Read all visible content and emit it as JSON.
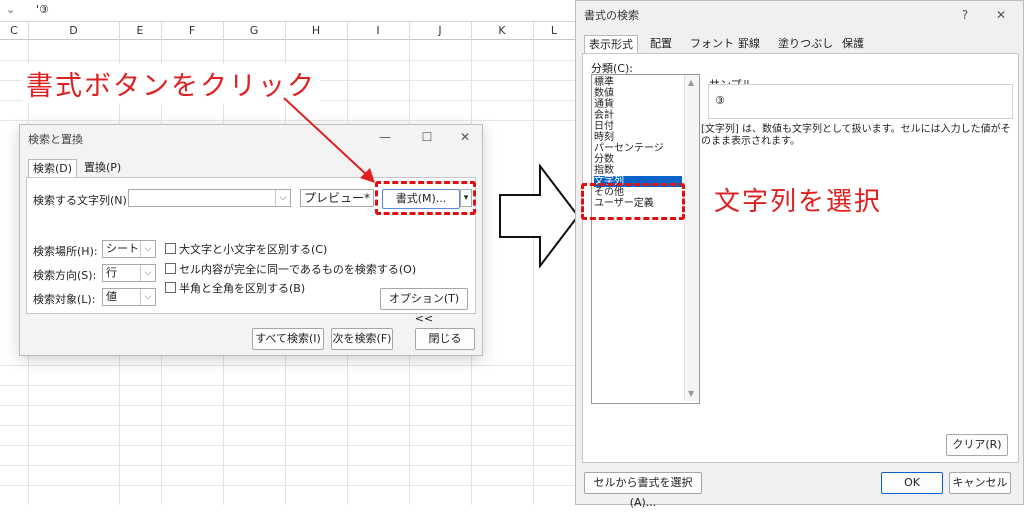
{
  "sheet": {
    "formula_value": "'③",
    "columns": [
      "C",
      "D",
      "E",
      "F",
      "G",
      "H",
      "I",
      "J",
      "K",
      "L"
    ]
  },
  "annotations": {
    "left": "書式ボタンをクリック",
    "right": "文字列を選択"
  },
  "find_dialog": {
    "title": "検索と置換",
    "tabs": [
      "検索(D)",
      "置換(P)"
    ],
    "search_label": "検索する文字列(N):",
    "search_value": "",
    "preview_label": "プレビュー*",
    "format_button": "書式(M)...",
    "within_label": "検索場所(H):",
    "within_value": "シート",
    "direction_label": "検索方向(S):",
    "direction_value": "行",
    "lookin_label": "検索対象(L):",
    "lookin_value": "値",
    "check_case": "大文字と小文字を区別する(C)",
    "check_entire": "セル内容が完全に同一であるものを検索する(O)",
    "check_width": "半角と全角を区別する(B)",
    "options_button": "オプション(T) <<",
    "find_all_button": "すべて検索(I)",
    "find_next_button": "次を検索(F)",
    "close_button": "閉じる"
  },
  "format_dialog": {
    "title": "書式の検索",
    "help": "?",
    "tabs": [
      "表示形式",
      "配置",
      "フォント",
      "罫線",
      "塗りつぶし",
      "保護"
    ],
    "category_label": "分類(C):",
    "categories": [
      "標準",
      "数値",
      "通貨",
      "会計",
      "日付",
      "時刻",
      "パーセンテージ",
      "分数",
      "指数",
      "文字列",
      "その他",
      "ユーザー定義"
    ],
    "selected_category": "文字列",
    "sample_label": "サンプル",
    "sample_value": "③",
    "description": "[文字列] は、数値も文字列として扱います。セルには入力した値がそのまま表示されます。",
    "clear_button": "クリア(R)",
    "from_cell_button": "セルから書式を選択(A)...",
    "ok_button": "OK",
    "cancel_button": "キャンセル"
  },
  "colors": {
    "accent": "#0a64c8",
    "annotation_red": "#e02020"
  }
}
